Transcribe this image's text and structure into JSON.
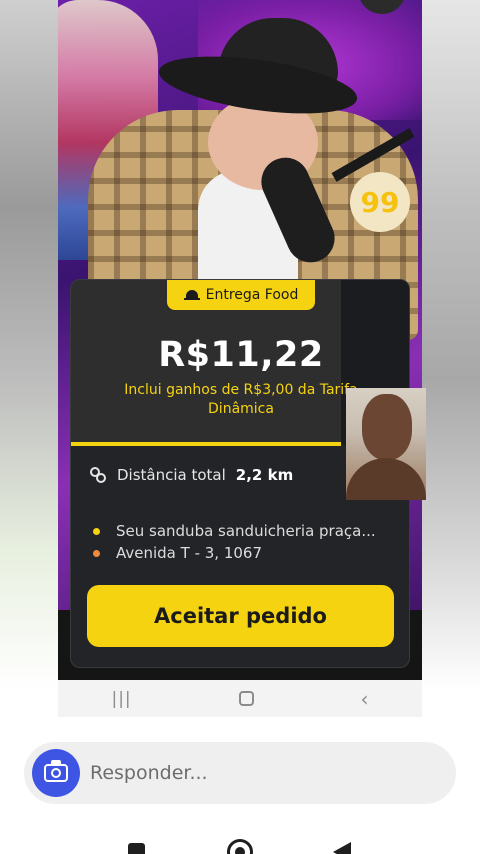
{
  "offer": {
    "tag_label": "Entrega Food",
    "price": "R$11,22",
    "price_note": "Inclui ganhos de R$3,00 da Tarifa Dinâmica",
    "distance_label": "Distância total",
    "distance_value": "2,2 km",
    "stops": [
      {
        "text": "Seu sanduba sanduicheria praça...",
        "dot_color": "#f5d311"
      },
      {
        "text": "Avenida T - 3, 1067",
        "dot_color": "#f08a3c"
      }
    ],
    "accept_label": "Aceitar pedido"
  },
  "brand": {
    "logo_text": "99",
    "accent": "#f5d311"
  },
  "reply": {
    "placeholder": "Responder..."
  },
  "icons": {
    "camera": "camera-icon",
    "bell": "food-bell-icon",
    "route": "route-icon"
  }
}
